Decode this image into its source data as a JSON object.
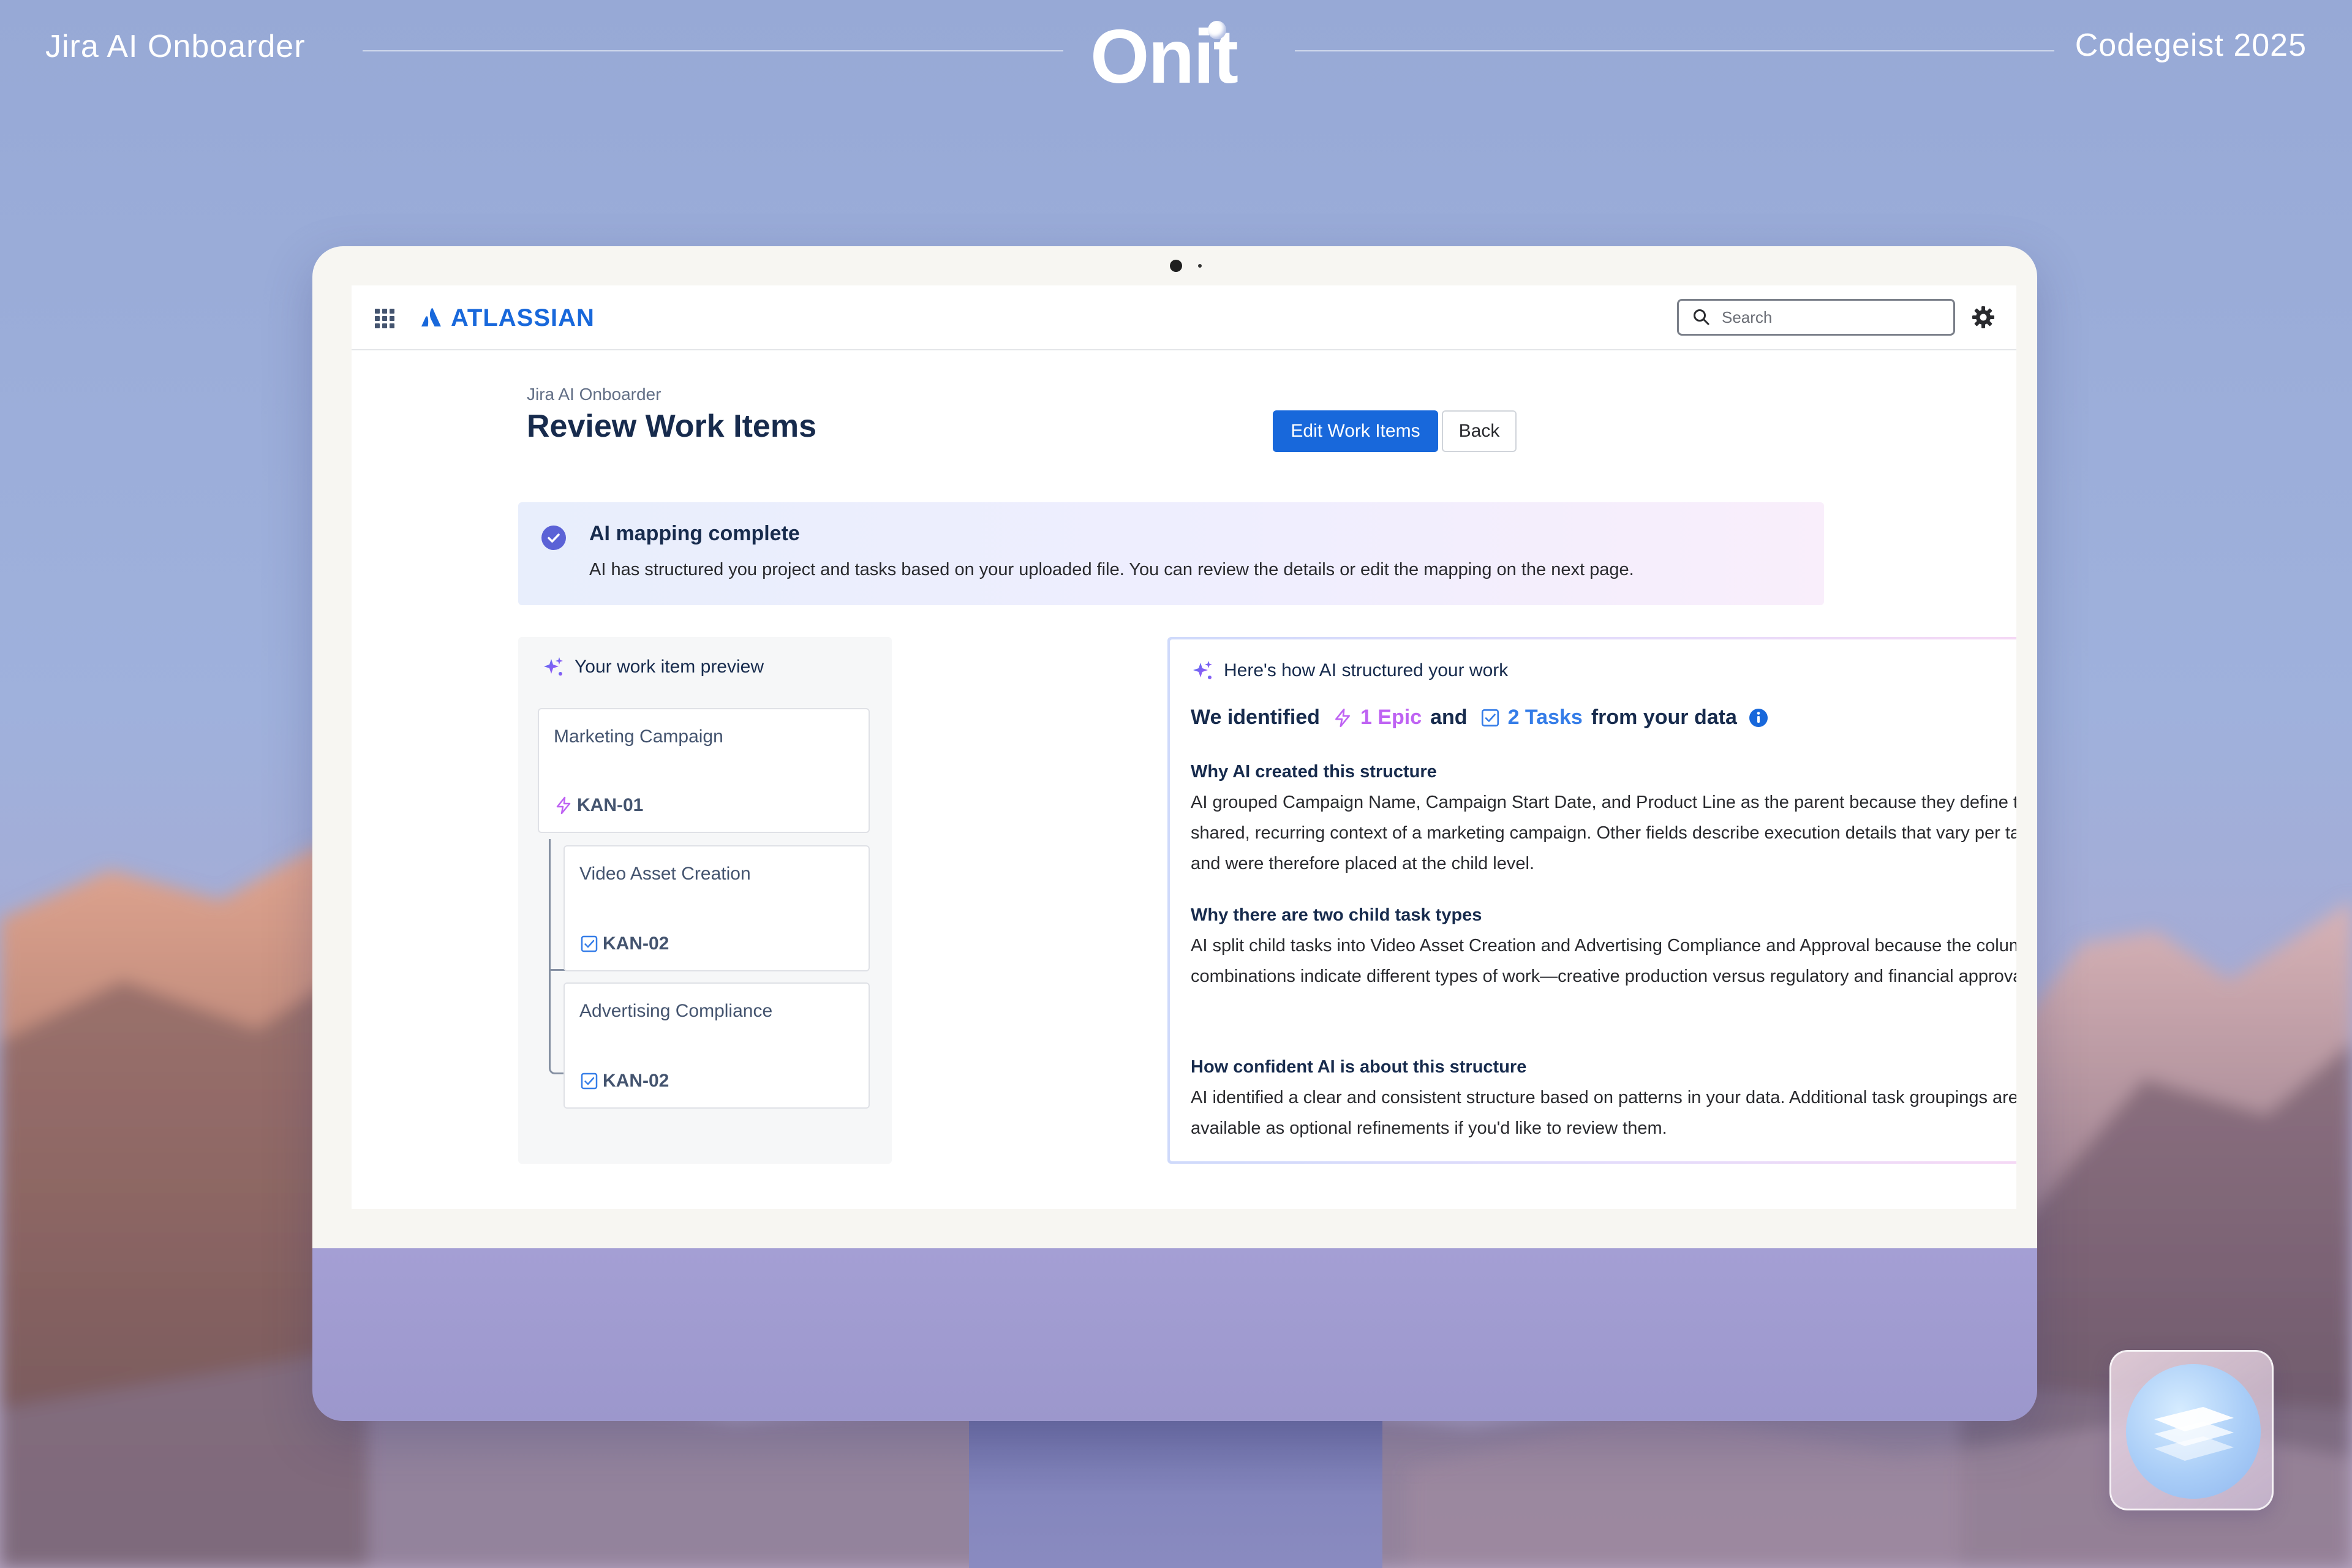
{
  "banner": {
    "left_text": "Jira AI Onboarder",
    "brand": "Onit",
    "right_text": "Codegeist 2025"
  },
  "topnav": {
    "logo_text": "ATLASSIAN",
    "search_placeholder": "Search"
  },
  "page": {
    "breadcrumb": "Jira AI Onboarder",
    "title": "Review Work Items",
    "edit_button": "Edit Work Items",
    "back_button": "Back"
  },
  "notice": {
    "title": "AI mapping complete",
    "body": "AI has structured you project and tasks based on your uploaded file. You can review the details or edit the mapping on the next page."
  },
  "preview": {
    "heading": "Your work item preview",
    "items": [
      {
        "title": "Marketing Campaign",
        "key": "KAN-01",
        "type": "epic"
      },
      {
        "title": "Video Asset Creation",
        "key": "KAN-02",
        "type": "task"
      },
      {
        "title": "Advertising Compliance",
        "key": "KAN-02",
        "type": "task"
      }
    ]
  },
  "explain": {
    "heading": "Here's how AI structured your work",
    "identified_prefix": "We identified",
    "epic_count": "1 Epic",
    "and_text": "and",
    "task_count": "2 Tasks",
    "suffix": "from your data",
    "sections": [
      {
        "title": "Why AI created this structure",
        "body": "AI grouped Campaign Name, Campaign Start Date, and Product Line as the parent because they define the shared, recurring context of a marketing campaign. Other fields describe execution details that vary per task and were therefore placed at the child level."
      },
      {
        "title": "Why there are two child task types",
        "body": "AI split child tasks into Video Asset Creation and Advertising Compliance and Approval because the column combinations indicate different types of work—creative production versus regulatory and financial approval."
      },
      {
        "title": "How confident AI is about this structure",
        "body": "AI identified a clear and consistent structure based on patterns in your data. Additional task groupings are available as optional refinements if you'd like to review them."
      }
    ]
  },
  "colors": {
    "atlassian_blue": "#1868db",
    "epic_purple": "#bf63f3",
    "task_blue": "#357de8",
    "text_primary": "#172b4d"
  }
}
